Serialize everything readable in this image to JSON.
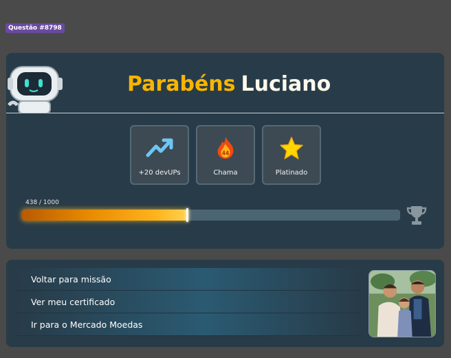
{
  "header": {
    "question_badge": "Questão #8798"
  },
  "congrats": {
    "word": "Parabéns",
    "name": "Luciano"
  },
  "badges": [
    {
      "label": "+20 devUPs",
      "icon": "trending-up-icon"
    },
    {
      "label": "Chama",
      "icon": "flame-icon",
      "value": "44"
    },
    {
      "label": "Platinado",
      "icon": "star-icon"
    }
  ],
  "progress": {
    "text": "438 / 1000",
    "current": 438,
    "max": 1000
  },
  "links": [
    {
      "label": "Voltar para missão"
    },
    {
      "label": "Ver meu certificado"
    },
    {
      "label": "Ir para o Mercado Moedas"
    }
  ],
  "colors": {
    "accent_yellow": "#f7b500",
    "card_bg": "#283b48",
    "page_bg": "#4a4a4a",
    "progress_orange": "#ffb21c",
    "badge_purple": "#6a4aa0"
  }
}
